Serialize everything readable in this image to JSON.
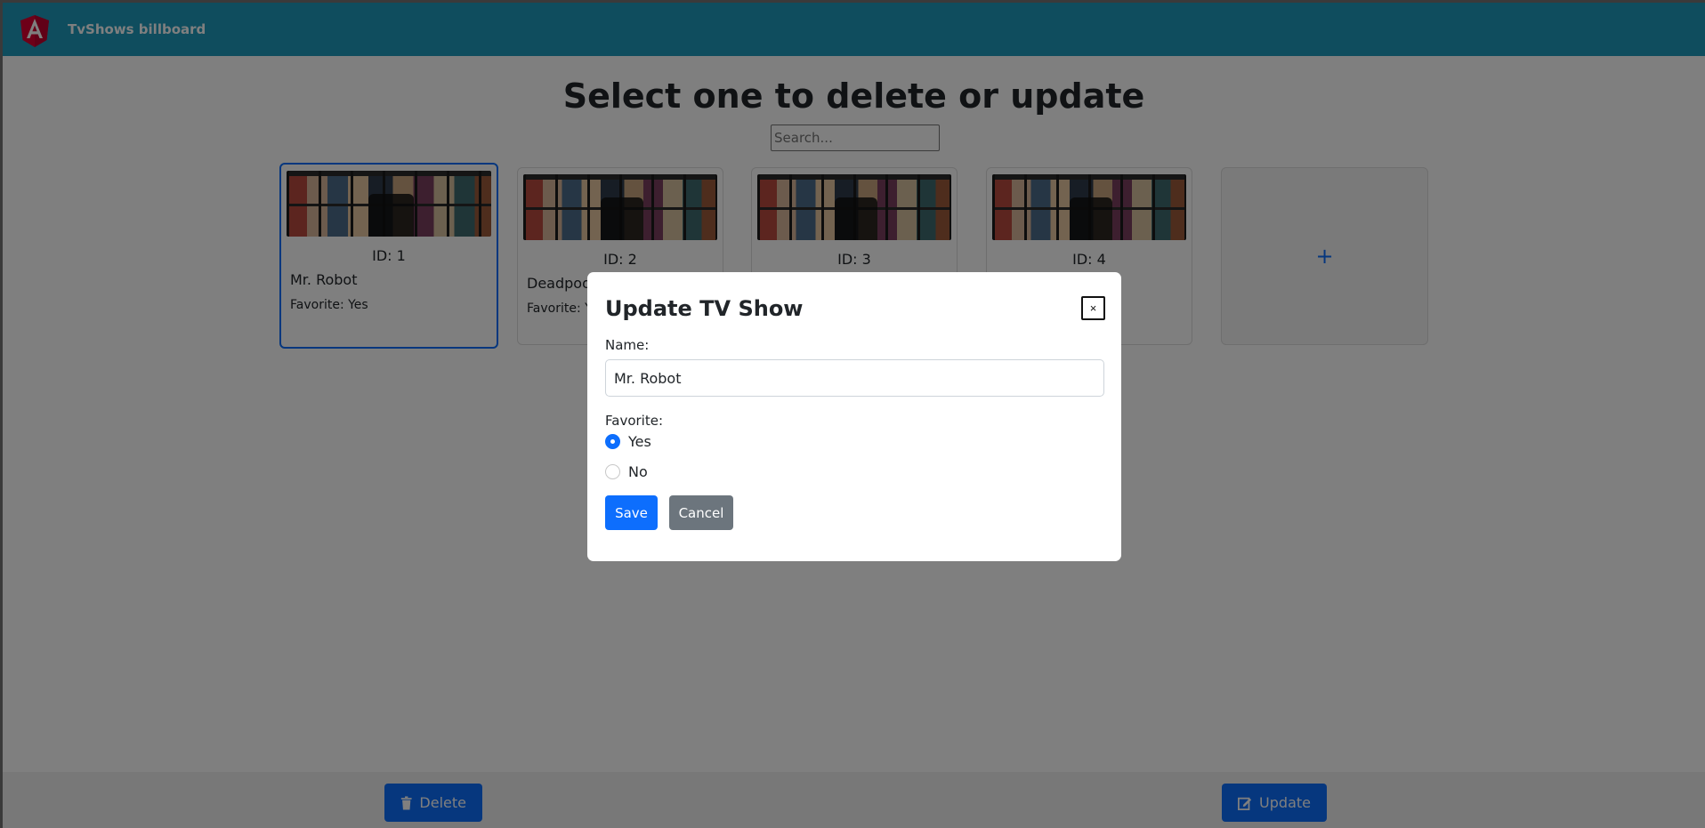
{
  "navbar": {
    "title": "TvShows billboard",
    "brand_color": "#1e9bbd",
    "logo_icon": "angular-logo-icon"
  },
  "main": {
    "heading": "Select one to delete or update",
    "search": {
      "placeholder": "Search...",
      "value": ""
    },
    "cards": [
      {
        "id_label": "ID: 1",
        "name": "Mr. Robot",
        "favorite": "Favorite: Yes",
        "selected": true
      },
      {
        "id_label": "ID: 2",
        "name": "Deadpool",
        "favorite": "Favorite: Ye"
      },
      {
        "id_label": "ID: 3",
        "name": "",
        "favorite": ""
      },
      {
        "id_label": "ID: 4",
        "name": "",
        "favorite": ""
      }
    ],
    "add_card": {
      "label": "+"
    }
  },
  "bottom": {
    "delete_label": "Delete",
    "update_label": "Update",
    "delete_icon": "trash-icon",
    "update_icon": "edit-icon"
  },
  "modal": {
    "title": "Update TV Show",
    "close_label": "×",
    "name_label": "Name:",
    "name_value": "Mr. Robot",
    "favorite_label": "Favorite:",
    "options": [
      "Yes",
      "No"
    ],
    "selected_option": "Yes",
    "save_label": "Save",
    "cancel_label": "Cancel"
  },
  "colors": {
    "primary": "#0d6efd",
    "secondary": "#6c757d"
  }
}
